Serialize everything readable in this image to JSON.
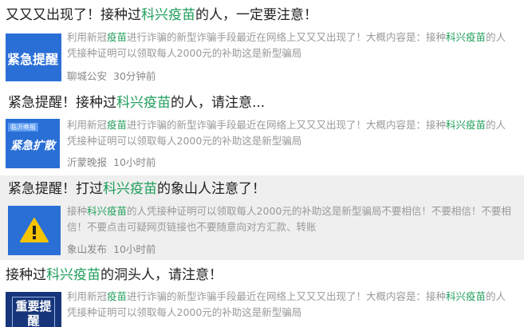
{
  "results": [
    {
      "title_pre": "又又又出现了！接种过",
      "title_hl": "科兴疫苗",
      "title_post": "的人，一定要注意！",
      "thumb_text": "紧急提醒",
      "snip_pre": "利用新冠",
      "snip_hl1": "疫苗",
      "snip_mid": "进行诈骗的新型诈骗手段最近在网络上又又又出现了！大概内容是：接种",
      "snip_hl2": "科兴疫苗",
      "snip_post": "的人凭接种证明可以领取每人2000元的补助这是新型骗局",
      "source": "聊城公安",
      "time": "30分钟前"
    },
    {
      "title_pre": "紧急提醒！接种过",
      "title_hl": "科兴疫苗",
      "title_post": "的人，请注意...",
      "thumb_badge": "临沂晚报",
      "thumb_text": "紧急扩散",
      "snip_pre": "利用新冠",
      "snip_hl1": "疫苗",
      "snip_mid": "进行诈骗的新型诈骗手段最近在网络上又又又出现了！大概内容是：接种",
      "snip_hl2": "科兴疫苗",
      "snip_post": "的人凭接种证明可以领取每人2000元的补助这是新型骗局",
      "source": "沂蒙晚报",
      "time": "10小时前"
    },
    {
      "title_pre": "紧急提醒！打过",
      "title_hl": "科兴疫苗",
      "title_post": "的象山人注意了！",
      "snip_pre": "接种",
      "snip_hl1": "科兴疫苗",
      "snip_mid": "的人凭接种证明可以领取每人2000元的补助这是新型骗局不要相信！不要相信！不要相信！不要点击可疑网页链接也不要随意向对方汇款、转账",
      "source": "象山发布",
      "time": "10小时前"
    },
    {
      "title_pre": "接种过",
      "title_hl": "科兴疫苗",
      "title_post": "的洞头人，请注意！",
      "thumb_text": "重要提醒",
      "snip_pre": "利用新冠",
      "snip_hl1": "疫苗",
      "snip_mid": "进行诈骗的新型诈骗手段最近在网络上又又又出现了！大概内容是：接种",
      "snip_hl2": "科兴疫苗",
      "snip_post": "的人凭接种证明可以领取每人2000元的补助这是新型骗局"
    }
  ],
  "colors": {
    "highlight": "#1e9e5a",
    "thumb_blue": "#2a6fd6",
    "thumb_navy": "#16357a",
    "warning": "#f5c400"
  }
}
